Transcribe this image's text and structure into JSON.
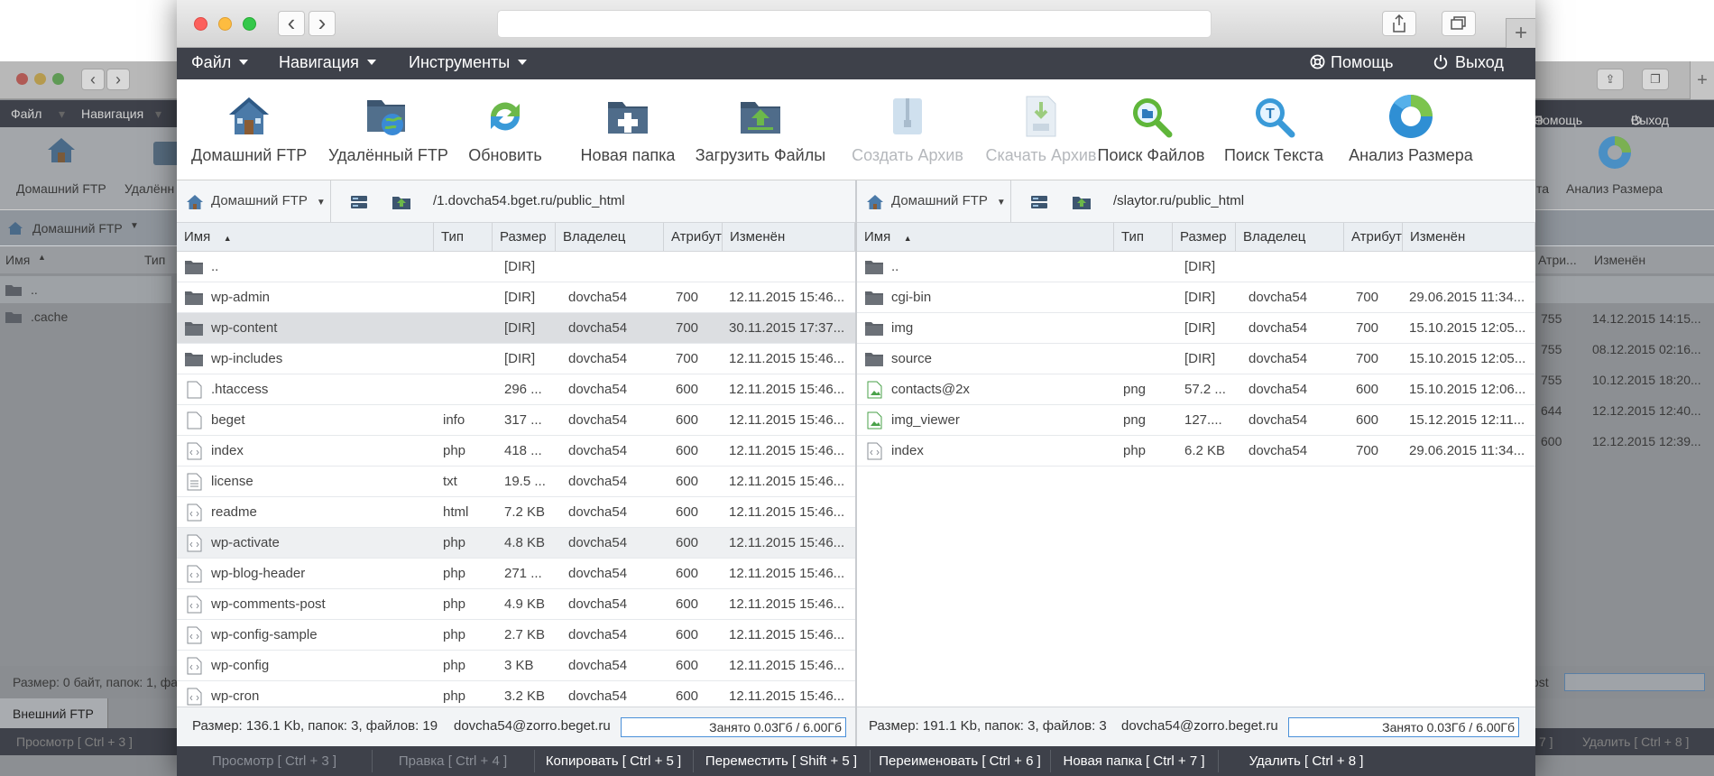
{
  "bg_window": {
    "menu": [
      "Файл",
      "Навигация"
    ],
    "tools": [
      "Домашний FTP",
      "Удалённ",
      "Анализ Размера",
      "та"
    ],
    "pathbar": {
      "location": "Домашний FTP"
    },
    "columns": [
      "Имя",
      "Тип",
      "Атри...",
      "Изменён"
    ],
    "left_rows": [
      "..",
      ".cache"
    ],
    "right_rows": [
      {
        "attr": "755",
        "modified": "14.12.2015 14:15..."
      },
      {
        "attr": "755",
        "modified": "08.12.2015 02:16..."
      },
      {
        "attr": "755",
        "modified": "10.12.2015 18:20..."
      },
      {
        "attr": "644",
        "modified": "12.12.2015 12:40..."
      },
      {
        "attr": "600",
        "modified": "12.12.2015 12:39..."
      }
    ],
    "right_menu": [
      "Помощь",
      "Выход"
    ],
    "status_left": "Размер: 0 байт, папок: 1, фа",
    "status_right": "ost",
    "tab": "Внешний FTP",
    "bottom_left": "Просмотр [ Ctrl + 3 ]",
    "bottom_right": [
      "7 ]",
      "Удалить [ Ctrl + 8 ]"
    ]
  },
  "titlebar": {
    "back": "‹",
    "forward": "›",
    "new_tab": "+"
  },
  "menu": {
    "left": [
      "Файл",
      "Навигация",
      "Инструменты"
    ],
    "help": "Помощь",
    "exit": "Выход"
  },
  "toolbar": [
    {
      "label": "Домашний FTP",
      "icon": "home-ftp-icon",
      "enabled": true
    },
    {
      "label": "Удалённый FTP",
      "icon": "remote-ftp-icon",
      "enabled": true
    },
    {
      "label": "Обновить",
      "icon": "refresh-icon",
      "enabled": true
    },
    {
      "label": "Новая папка",
      "icon": "new-folder-icon",
      "enabled": true
    },
    {
      "label": "Загрузить Файлы",
      "icon": "upload-files-icon",
      "enabled": true
    },
    {
      "label": "Создать Архив",
      "icon": "create-archive-icon",
      "enabled": false
    },
    {
      "label": "Скачать Архив",
      "icon": "download-archive-icon",
      "enabled": false
    },
    {
      "label": "Поиск Файлов",
      "icon": "search-files-icon",
      "enabled": true
    },
    {
      "label": "Поиск Текста",
      "icon": "search-text-icon",
      "enabled": true
    },
    {
      "label": "Анализ Размера",
      "icon": "size-analysis-icon",
      "enabled": true
    }
  ],
  "columns": [
    "Имя",
    "Тип",
    "Размер",
    "Владелец",
    "Атрибуты",
    "Изменён"
  ],
  "left": {
    "location": "Домашний FTP",
    "path": "/1.dovcha54.bget.ru/public_html",
    "rows": [
      {
        "name": "..",
        "type": "",
        "size": "[DIR]",
        "owner": "",
        "attr": "",
        "modified": "",
        "kind": "folder"
      },
      {
        "name": "wp-admin",
        "type": "",
        "size": "[DIR]",
        "owner": "dovcha54",
        "attr": "700",
        "modified": "12.11.2015 15:46...",
        "kind": "folder"
      },
      {
        "name": "wp-content",
        "type": "",
        "size": "[DIR]",
        "owner": "dovcha54",
        "attr": "700",
        "modified": "30.11.2015 17:37...",
        "kind": "folder",
        "selected": true
      },
      {
        "name": "wp-includes",
        "type": "",
        "size": "[DIR]",
        "owner": "dovcha54",
        "attr": "700",
        "modified": "12.11.2015 15:46...",
        "kind": "folder"
      },
      {
        "name": ".htaccess",
        "type": "",
        "size": "296 ...",
        "owner": "dovcha54",
        "attr": "600",
        "modified": "12.11.2015 15:46...",
        "kind": "file"
      },
      {
        "name": "beget",
        "type": "info",
        "size": "317 ...",
        "owner": "dovcha54",
        "attr": "600",
        "modified": "12.11.2015 15:46...",
        "kind": "file"
      },
      {
        "name": "index",
        "type": "php",
        "size": "418 ...",
        "owner": "dovcha54",
        "attr": "600",
        "modified": "12.11.2015 15:46...",
        "kind": "code"
      },
      {
        "name": "license",
        "type": "txt",
        "size": "19.5 ...",
        "owner": "dovcha54",
        "attr": "600",
        "modified": "12.11.2015 15:46...",
        "kind": "text"
      },
      {
        "name": "readme",
        "type": "html",
        "size": "7.2 KB",
        "owner": "dovcha54",
        "attr": "600",
        "modified": "12.11.2015 15:46...",
        "kind": "code"
      },
      {
        "name": "wp-activate",
        "type": "php",
        "size": "4.8 KB",
        "owner": "dovcha54",
        "attr": "600",
        "modified": "12.11.2015 15:46...",
        "kind": "code",
        "hover": true
      },
      {
        "name": "wp-blog-header",
        "type": "php",
        "size": "271 ...",
        "owner": "dovcha54",
        "attr": "600",
        "modified": "12.11.2015 15:46...",
        "kind": "code"
      },
      {
        "name": "wp-comments-post",
        "type": "php",
        "size": "4.9 KB",
        "owner": "dovcha54",
        "attr": "600",
        "modified": "12.11.2015 15:46...",
        "kind": "code"
      },
      {
        "name": "wp-config-sample",
        "type": "php",
        "size": "2.7 KB",
        "owner": "dovcha54",
        "attr": "600",
        "modified": "12.11.2015 15:46...",
        "kind": "code"
      },
      {
        "name": "wp-config",
        "type": "php",
        "size": "3 KB",
        "owner": "dovcha54",
        "attr": "600",
        "modified": "12.11.2015 15:46...",
        "kind": "code"
      },
      {
        "name": "wp-cron",
        "type": "php",
        "size": "3.2 KB",
        "owner": "dovcha54",
        "attr": "600",
        "modified": "12.11.2015 15:46...",
        "kind": "code"
      }
    ],
    "status": "Размер: 136.1 Kb, папок: 3, файлов: 19",
    "user": "dovcha54@zorro.beget.ru",
    "quota": "Занято 0.03Гб / 6.00Гб"
  },
  "right": {
    "location": "Домашний FTP",
    "path": "/slaytor.ru/public_html",
    "rows": [
      {
        "name": "..",
        "type": "",
        "size": "[DIR]",
        "owner": "",
        "attr": "",
        "modified": "",
        "kind": "folder"
      },
      {
        "name": "cgi-bin",
        "type": "",
        "size": "[DIR]",
        "owner": "dovcha54",
        "attr": "700",
        "modified": "29.06.2015 11:34...",
        "kind": "folder"
      },
      {
        "name": "img",
        "type": "",
        "size": "[DIR]",
        "owner": "dovcha54",
        "attr": "700",
        "modified": "15.10.2015 12:05...",
        "kind": "folder"
      },
      {
        "name": "source",
        "type": "",
        "size": "[DIR]",
        "owner": "dovcha54",
        "attr": "700",
        "modified": "15.10.2015 12:05...",
        "kind": "folder"
      },
      {
        "name": "contacts@2x",
        "type": "png",
        "size": "57.2 ...",
        "owner": "dovcha54",
        "attr": "600",
        "modified": "15.10.2015 12:06...",
        "kind": "image"
      },
      {
        "name": "img_viewer",
        "type": "png",
        "size": "127....",
        "owner": "dovcha54",
        "attr": "600",
        "modified": "15.12.2015 12:11...",
        "kind": "image"
      },
      {
        "name": "index",
        "type": "php",
        "size": "6.2 KB",
        "owner": "dovcha54",
        "attr": "700",
        "modified": "29.06.2015 11:34...",
        "kind": "code"
      }
    ],
    "status": "Размер: 191.1 Kb, папок: 3, файлов: 3",
    "user": "dovcha54@zorro.beget.ru",
    "quota": "Занято 0.03Гб / 6.00Гб"
  },
  "bottom": [
    {
      "label": "Просмотр [ Ctrl + 3 ]",
      "enabled": false
    },
    {
      "label": "Правка [ Ctrl + 4 ]",
      "enabled": false
    },
    {
      "label": "Копировать [ Ctrl + 5 ]",
      "enabled": true
    },
    {
      "label": "Переместить [ Shift + 5 ]",
      "enabled": true
    },
    {
      "label": "Переименовать [ Ctrl + 6 ]",
      "enabled": true
    },
    {
      "label": "Новая папка [ Ctrl + 7 ]",
      "enabled": true
    },
    {
      "label": "Удалить [ Ctrl + 8 ]",
      "enabled": true
    }
  ],
  "colors": {
    "accent": "#4a90d9",
    "menubar": "#3e414a",
    "selected_row": "#dcdee1",
    "folder": "#6c7178",
    "disabled_text": "#b5b8bc"
  }
}
